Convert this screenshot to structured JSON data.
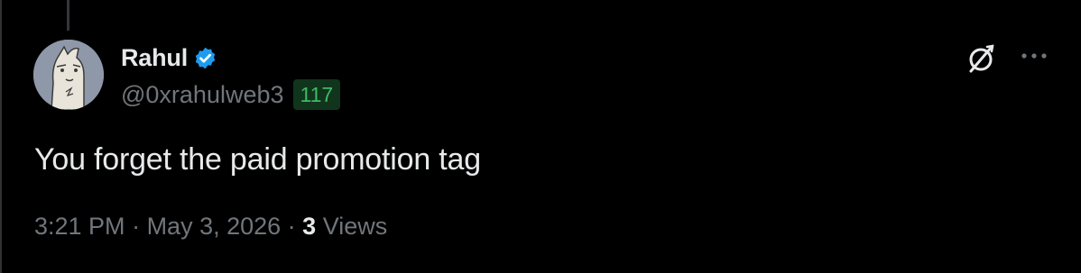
{
  "author": {
    "display_name": "Rahul",
    "handle": "@0xrahulweb3",
    "badge_count": "117",
    "verified_icon": "verified-badge-icon",
    "avatar_icon": "avatar-illustration"
  },
  "post": {
    "text": "You forget the paid promotion tag",
    "time": "3:21 PM",
    "separator1": " · ",
    "date": "May 3, 2026",
    "separator2": " · ",
    "views_count": "3",
    "views_label": " Views"
  },
  "actions": {
    "grok_icon": "grok-icon",
    "more_icon": "more-options-icon"
  },
  "colors": {
    "background": "#000000",
    "primary_text": "#e7e9ea",
    "secondary_text": "#71767b",
    "verified_blue": "#1d9bf0",
    "badge_bg": "#11341c",
    "badge_text": "#3dbb63"
  }
}
